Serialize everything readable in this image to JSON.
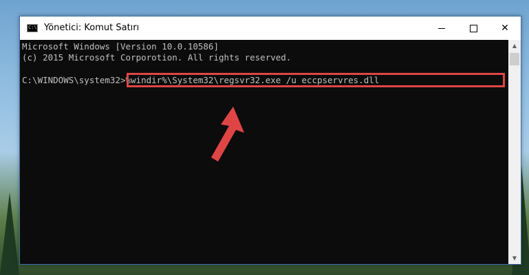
{
  "window": {
    "title": "Yönetici: Komut Satırı",
    "icon_label": "C:\\",
    "controls": {
      "minimize": "minimize-icon",
      "maximize": "maximize-icon",
      "close": "✕"
    }
  },
  "console": {
    "line1": "Microsoft Windows [Version 10.0.10586]",
    "line2": "(c) 2015 Microsoft Corporotion. All rights reserved.",
    "prompt": "C:\\WINDOWS\\system32>",
    "command": "%windir%\\System32\\regsvr32.exe /u eccpservres.dll"
  },
  "annotation": {
    "highlight_color": "#e04545",
    "arrow_color": "#e04545"
  }
}
